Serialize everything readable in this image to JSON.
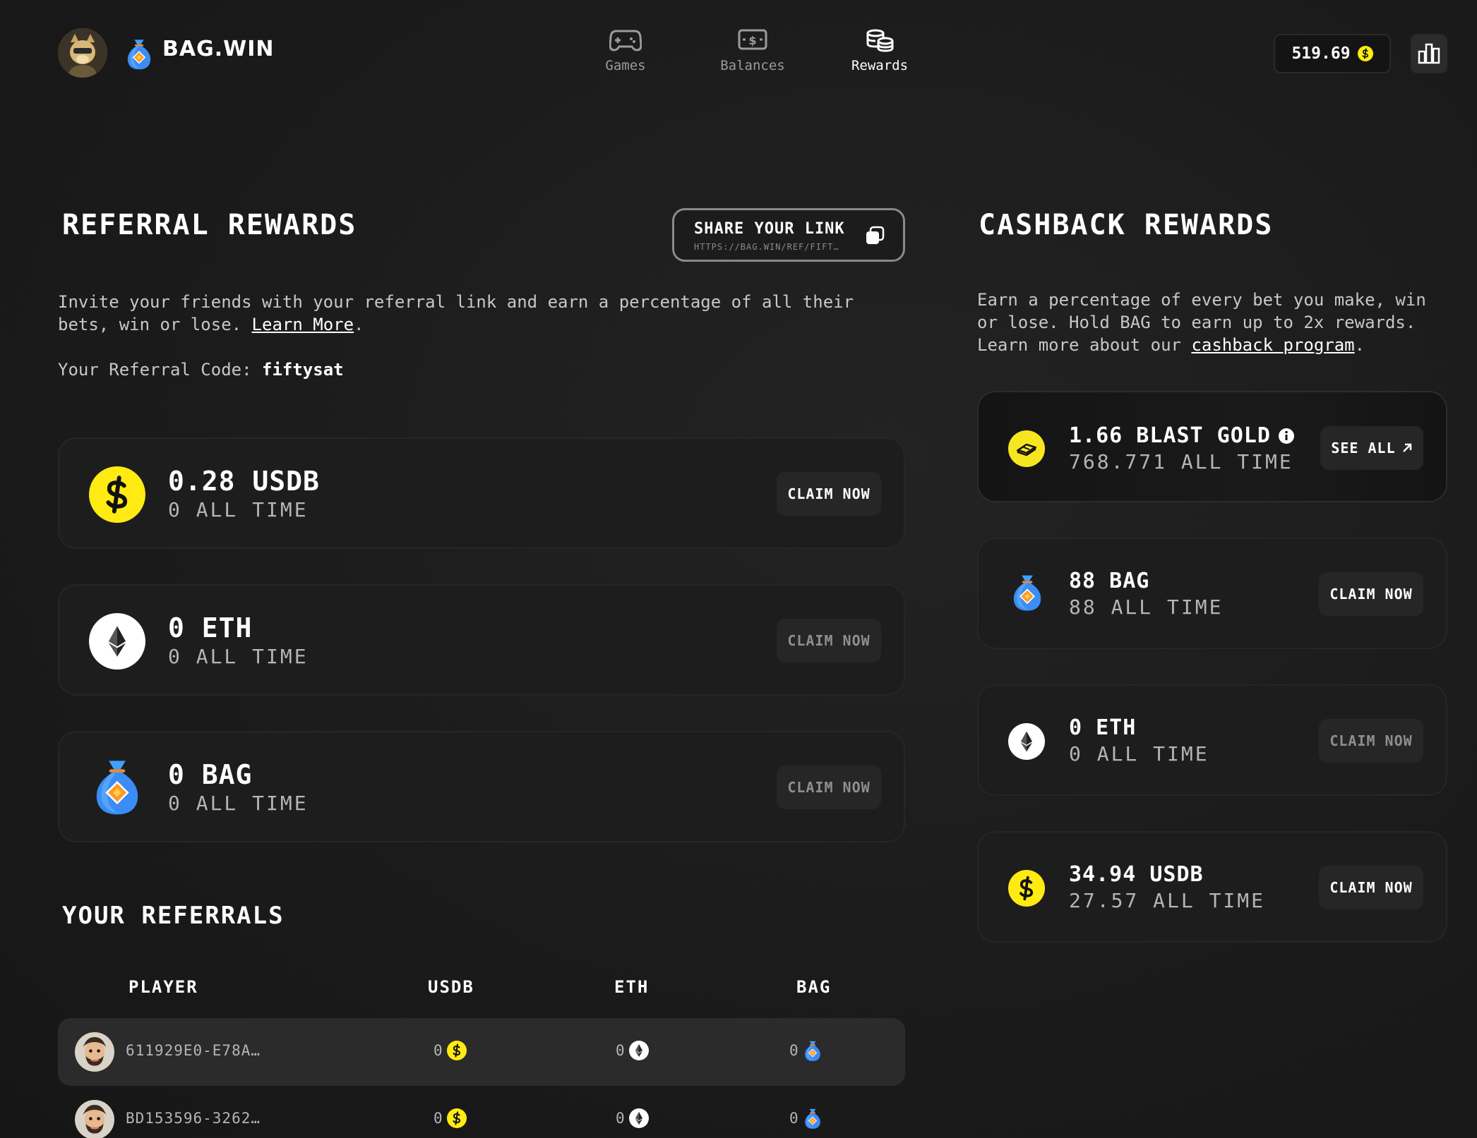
{
  "header": {
    "brand": "BAG.WIN",
    "nav": [
      {
        "label": "Games",
        "icon": "gamepad-icon",
        "active": false
      },
      {
        "label": "Balances",
        "icon": "cash-icon",
        "active": false
      },
      {
        "label": "Rewards",
        "icon": "coins-stack-icon",
        "active": true
      }
    ],
    "balance": "519.69",
    "colors": {
      "usdb": "#ffeb12",
      "accent": "#ffffff"
    }
  },
  "referral": {
    "title": "REFERRAL REWARDS",
    "share_title": "SHARE YOUR LINK",
    "share_link": "HTTPS://BAG.WIN/REF/FIFT…",
    "desc": "Invite your friends with your referral link and earn a percentage of all their bets, win or lose.",
    "learn_more": "Learn More",
    "code_label": "Your Referral Code:",
    "code": "fiftysat",
    "cards": [
      {
        "amount": "0.28 USDB",
        "alltime": "0 ALL TIME",
        "claim": "CLAIM NOW",
        "icon": "usdb-coin-icon"
      },
      {
        "amount": "0 ETH",
        "alltime": "0 ALL TIME",
        "claim": "CLAIM NOW",
        "icon": "eth-coin-icon"
      },
      {
        "amount": "0 BAG",
        "alltime": "0 ALL TIME",
        "claim": "CLAIM NOW",
        "icon": "bag-icon"
      }
    ]
  },
  "cashback": {
    "title": "CASHBACK REWARDS",
    "desc": "Earn a percentage of every bet you make, win or lose. Hold BAG to earn up to 2x rewards. Learn more about our",
    "link": "cashback program",
    "gold": {
      "amount": "1.66 BLAST GOLD",
      "alltime": "768.771 ALL TIME",
      "see_all": "SEE ALL"
    },
    "cards": [
      {
        "amount": "88 BAG",
        "alltime": "88 ALL TIME",
        "claim": "CLAIM NOW"
      },
      {
        "amount": "0 ETH",
        "alltime": "0 ALL TIME",
        "claim": "CLAIM NOW"
      },
      {
        "amount": "34.94 USDB",
        "alltime": "27.57 ALL TIME",
        "claim": "CLAIM NOW"
      }
    ]
  },
  "referrals": {
    "title": "YOUR REFERRALS",
    "columns": [
      "PLAYER",
      "USDB",
      "ETH",
      "BAG"
    ],
    "rows": [
      {
        "player": "611929E0-E78A…",
        "usdb": "0",
        "eth": "0",
        "bag": "0"
      },
      {
        "player": "BD153596-3262…",
        "usdb": "0",
        "eth": "0",
        "bag": "0"
      }
    ]
  }
}
